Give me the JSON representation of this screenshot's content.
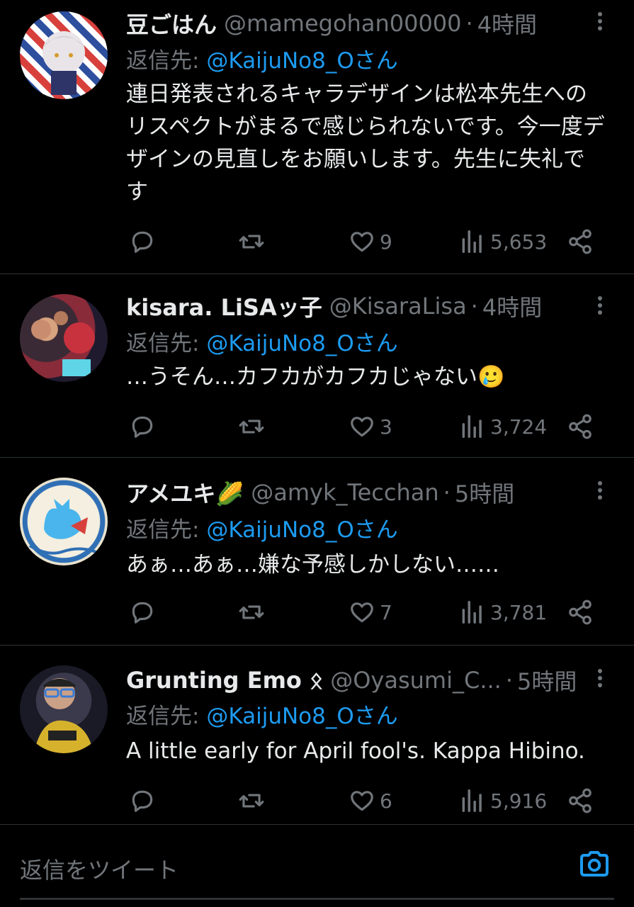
{
  "tweets": [
    {
      "name": "豆ごはん",
      "handle": "@mamegohan00000",
      "time": "4時間",
      "reply_prefix": "返信先: ",
      "reply_to": "@KaijuNo8_Oさん",
      "text": "連日発表されるキャラデザインは松本先生へのリスペクトがまるで感じられないです。今一度デザインの見直しをお願いします。先生に失礼です",
      "reply_count": "",
      "retweet_count": "",
      "like_count": "9",
      "view_count": "5,653"
    },
    {
      "name": "kisara. LiSAッ子",
      "handle": "@KisaraLisa",
      "time": "4時間",
      "reply_prefix": "返信先: ",
      "reply_to": "@KaijuNo8_Oさん",
      "text": "…うそん…カフカがカフカじゃない🥲",
      "reply_count": "",
      "retweet_count": "",
      "like_count": "3",
      "view_count": "3,724"
    },
    {
      "name": "アメユキ🌽",
      "handle": "@amyk_Tecchan",
      "time": "5時間",
      "reply_prefix": "返信先: ",
      "reply_to": "@KaijuNo8_Oさん",
      "text": "あぁ…あぁ…嫌な予感しかしない……",
      "reply_count": "",
      "retweet_count": "",
      "like_count": "7",
      "view_count": "3,781"
    },
    {
      "name": "Grunting Emo ᛟ",
      "handle": "@Oyasumi_C...",
      "time": "5時間",
      "reply_prefix": "返信先: ",
      "reply_to": "@KaijuNo8_Oさん",
      "text": "A little early for April fool's. Kappa Hibino.",
      "reply_count": "",
      "retweet_count": "",
      "like_count": "6",
      "view_count": "5,916"
    }
  ],
  "composer": {
    "placeholder": "返信をツイート",
    "icon": "camera-icon"
  },
  "colors": {
    "background": "#000000",
    "text": "#e7e9ea",
    "secondary": "#71767b",
    "accent": "#1d9bf0",
    "divider": "#2f3336"
  }
}
